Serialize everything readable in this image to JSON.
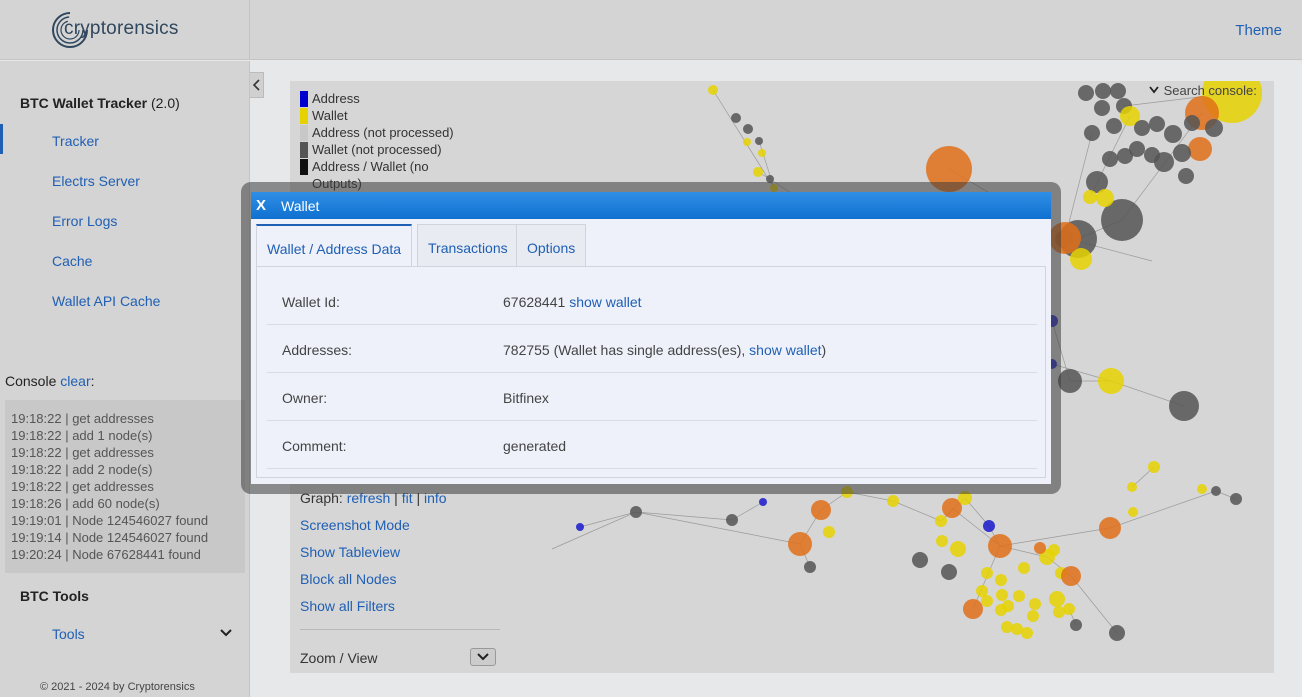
{
  "header": {
    "logo_text": "cryptorensics",
    "theme_label": "Theme"
  },
  "sidebar": {
    "section1_title": "BTC Wallet Tracker",
    "section1_version": "(2.0)",
    "items": [
      {
        "label": "Tracker"
      },
      {
        "label": "Electrs Server"
      },
      {
        "label": "Error Logs"
      },
      {
        "label": "Cache"
      },
      {
        "label": "Wallet API Cache"
      }
    ],
    "console_label": "Console",
    "console_clear": "clear",
    "console_suffix": ":",
    "console_lines": [
      "19:18:22 | get addresses",
      "19:18:22 | add 1 node(s)",
      "19:18:22 | get addresses",
      "19:18:22 | add 2 node(s)",
      "19:18:22 | get addresses",
      "19:18:26 | add 60 node(s)",
      "19:19:01 | Node 124546027 found",
      "19:19:14 | Node 124546027 found",
      "19:20:24 | Node 67628441 found"
    ],
    "section2_title": "BTC Tools",
    "tools_label": "Tools",
    "footer": "© 2021 - 2024 by Cryptorensics"
  },
  "panel": {
    "legend": [
      {
        "label": "Address",
        "color": "#0000cc"
      },
      {
        "label": "Wallet",
        "color": "#e6d200"
      },
      {
        "label": "Address (not processed)",
        "color": "#c8c8c8"
      },
      {
        "label": "Wallet (not processed)",
        "color": "#555555"
      },
      {
        "label": "Address / Wallet (no Outputs)",
        "color": "#111111"
      }
    ],
    "graph_label": "Graph:",
    "graph_refresh": "refresh",
    "graph_sep1": "|",
    "graph_fit": "fit",
    "graph_sep2": "|",
    "graph_info": "info",
    "links": [
      "Screenshot Mode",
      "Show Tableview",
      "Block all Nodes",
      "Show all Filters"
    ],
    "zoom_label": "Zoom / View"
  },
  "graph": {
    "search_console": "Search console:"
  },
  "dialog": {
    "close": "X",
    "title": "Wallet",
    "tabs": [
      {
        "label": "Wallet / Address Data"
      },
      {
        "label": "Transactions"
      },
      {
        "label": "Options"
      }
    ],
    "rows": {
      "wallet_id_label": "Wallet Id:",
      "wallet_id_value": "67628441",
      "wallet_id_link": "show wallet",
      "addresses_label": "Addresses:",
      "addresses_value": "782755 (Wallet has single address(es),",
      "addresses_link": "show wallet",
      "addresses_close": ")",
      "owner_label": "Owner:",
      "owner_value": "Bitfinex",
      "comment_label": "Comment:",
      "comment_value": "generated"
    }
  },
  "colors": {
    "accent": "#1f5fb4",
    "wallet_yellow": "#e6d200",
    "orange": "#e0701a",
    "gray_node": "#555555",
    "address_blue": "#1a1acc"
  }
}
